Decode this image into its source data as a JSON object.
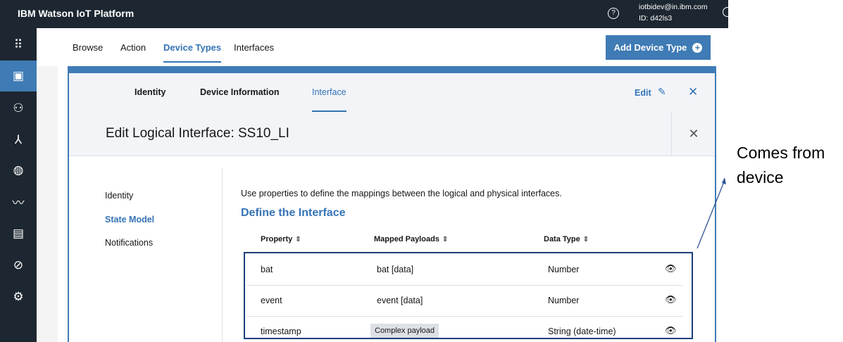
{
  "app": {
    "title": "IBM Watson IoT Platform",
    "help_icon": "?",
    "user_email": "iotbidev@in.ibm.com",
    "user_id": "ID: d42ls3"
  },
  "rail": {
    "items": [
      {
        "icon": "apps-grid-icon",
        "glyph": "⠿"
      },
      {
        "icon": "chip-icon",
        "glyph": "▣",
        "active": true
      },
      {
        "icon": "members-icon",
        "glyph": "⚇"
      },
      {
        "icon": "rules-icon",
        "glyph": "⅄"
      },
      {
        "icon": "globe-icon",
        "glyph": "◍"
      },
      {
        "icon": "usage-chart-icon",
        "glyph": "〰"
      },
      {
        "icon": "document-icon",
        "glyph": "▤"
      },
      {
        "icon": "security-icon",
        "glyph": "⊘"
      },
      {
        "icon": "settings-icon",
        "glyph": "⚙"
      }
    ]
  },
  "nav": {
    "tabs": [
      "Browse",
      "Action",
      "Device Types",
      "Interfaces"
    ],
    "active": "Device Types",
    "add_button": "Add Device Type",
    "add_icon": "+"
  },
  "subtabs": {
    "items": [
      "Identity",
      "Device Information",
      "Interface"
    ],
    "active": "Interface",
    "edit": "Edit",
    "pencil_icon": "✎",
    "close_icon": "✕"
  },
  "panel": {
    "title": "Edit Logical Interface: SS10_LI",
    "close_icon": "✕"
  },
  "sidemenu": [
    "Identity",
    "State Model",
    "Notifications"
  ],
  "sidemenu_active": "State Model",
  "description": "Use properties to define the mappings between the logical and physical interfaces.",
  "section_title": "Define the Interface",
  "table": {
    "headers": [
      "Property",
      "Mapped Payloads",
      "Data Type"
    ],
    "sort_icon": "⇕",
    "rows": [
      {
        "property": "bat",
        "mapped": "bat [data]",
        "type": "Number",
        "badge": false
      },
      {
        "property": "event",
        "mapped": "event [data]",
        "type": "Number",
        "badge": false
      },
      {
        "property": "timestamp",
        "mapped": "Complex payload",
        "type": "String (date-time)",
        "badge": true
      }
    ],
    "view_icon": "👁"
  },
  "annotation": {
    "text_line1": "Comes from",
    "text_line2": "device"
  },
  "colors": {
    "topbar": "#1d2731",
    "accent": "#3f7bb5",
    "link": "#3573b5",
    "box_border": "#1c3f7a"
  }
}
